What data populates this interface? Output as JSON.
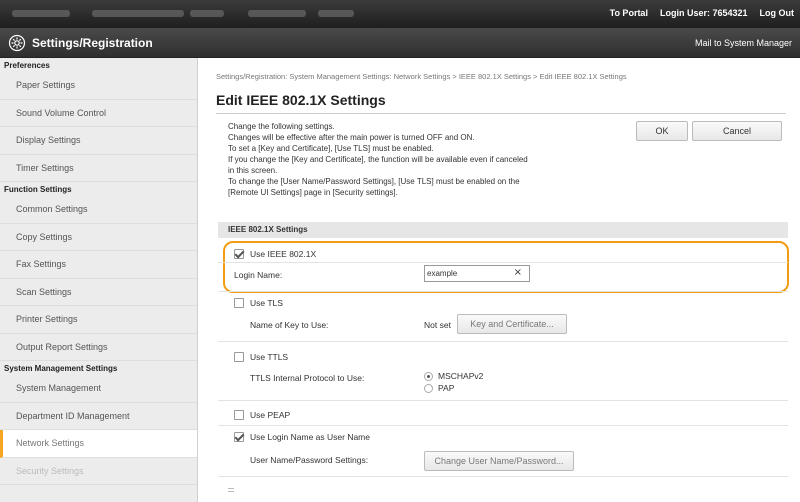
{
  "topbar": {
    "portal_link": "To Portal",
    "login_user": "Login User: 7654321",
    "logout_link": "Log Out"
  },
  "header": {
    "title": "Settings/Registration",
    "mail_link": "Mail to System Manager"
  },
  "sidebar": {
    "sections": [
      {
        "heading": "Preferences",
        "items": [
          "Paper Settings",
          "Sound Volume Control",
          "Display Settings",
          "Timer Settings"
        ]
      },
      {
        "heading": "Function Settings",
        "items": [
          "Common Settings",
          "Copy Settings",
          "Fax Settings",
          "Scan Settings",
          "Printer Settings",
          "Output Report Settings"
        ]
      },
      {
        "heading": "System Management Settings",
        "items": [
          "System Management",
          "Department ID Management",
          "Network Settings",
          "Security Settings"
        ]
      }
    ],
    "active_item": "Network Settings"
  },
  "main": {
    "breadcrumb": "Settings/Registration: System Management Settings: Network Settings > IEEE 802.1X Settings > Edit IEEE 802.1X Settings",
    "page_title": "Edit IEEE 802.1X Settings",
    "description": [
      "Change the following settings.",
      "Changes will be effective after the main power is turned OFF and ON.",
      "To set a [Key and Certificate], [Use TLS] must be enabled.",
      "If you change the [Key and Certificate], the function will be available even if canceled",
      "in this screen.",
      "To change the [User Name/Password Settings], [Use TLS] must be enabled on the",
      "[Remote UI Settings] page in [Security settings]."
    ],
    "ok_label": "OK",
    "cancel_label": "Cancel",
    "section_heading": "IEEE 802.1X Settings",
    "use_ieee_label": "Use IEEE 802.1X",
    "login_name_label": "Login Name:",
    "login_name_value": "example",
    "clear_glyph": "×",
    "use_tls_label": "Use TLS",
    "key_name_label": "Name of Key to Use:",
    "key_name_value": "Not set",
    "key_cert_button": "Key and Certificate...",
    "use_ttls_label": "Use TTLS",
    "ttls_protocol_label": "TTLS Internal Protocol to Use:",
    "ttls_options": [
      "MSCHAPv2",
      "PAP"
    ],
    "ttls_selected": "MSCHAPv2",
    "use_peap_label": "Use PEAP",
    "use_login_as_user_label": "Use Login Name as User Name",
    "user_pass_label": "User Name/Password Settings:",
    "change_user_button": "Change User Name/Password..."
  },
  "checkboxes": {
    "use_ieee": true,
    "use_tls": false,
    "use_ttls": false,
    "use_peap": false,
    "use_login_as_user": true
  },
  "colors": {
    "highlight": "#f39c12",
    "sidebar_bg": "#ececec",
    "header_bg": "#2f2f2f"
  }
}
